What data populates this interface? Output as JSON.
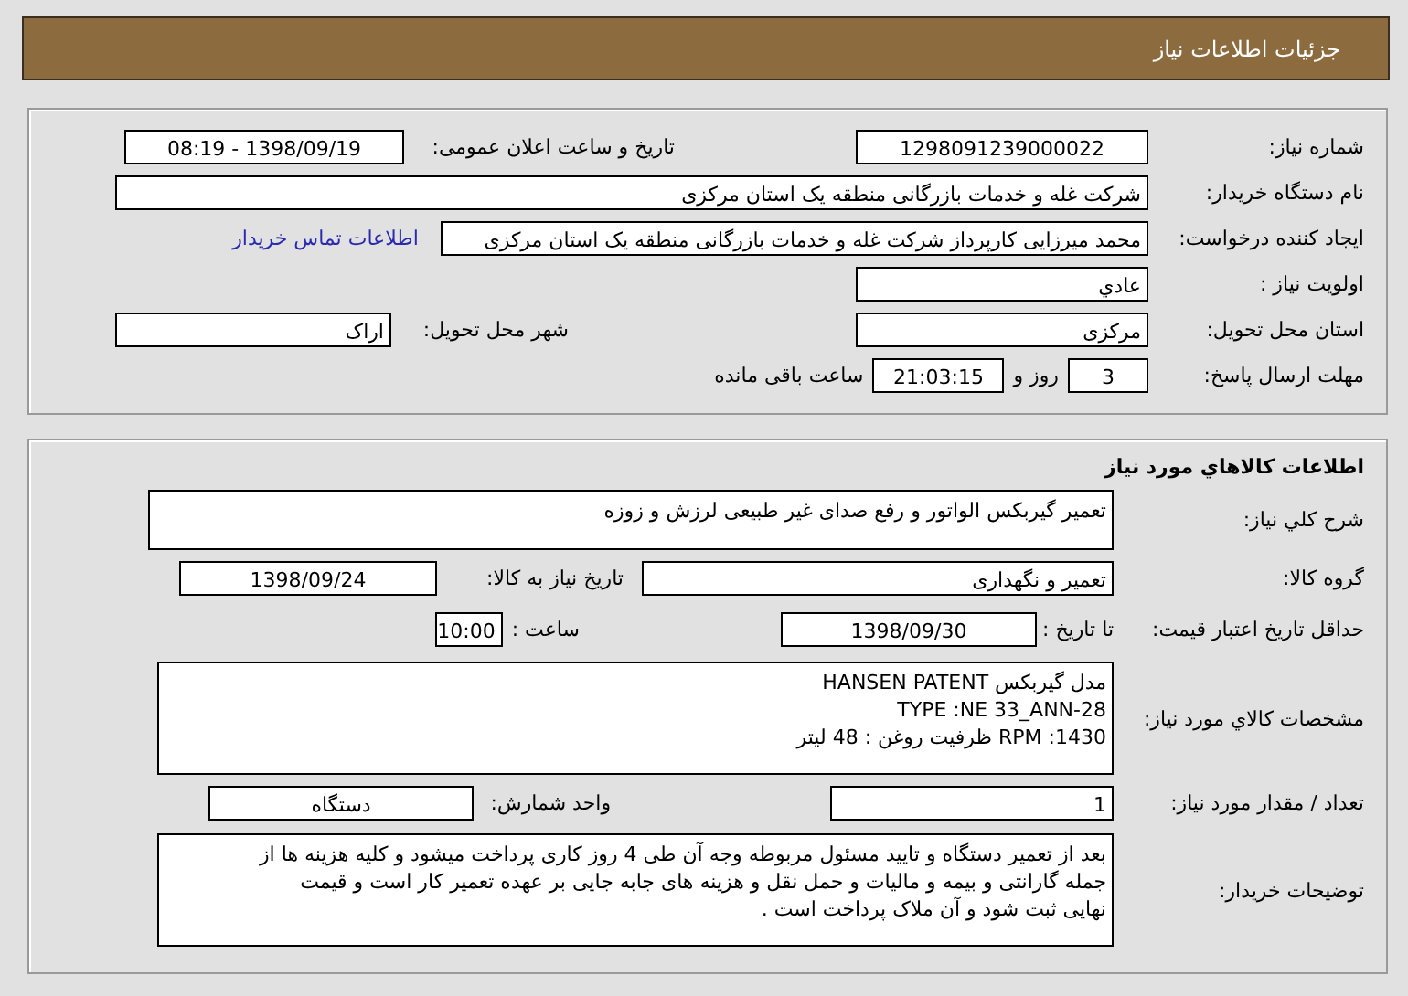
{
  "header": {
    "title": "جزئیات اطلاعات نیاز"
  },
  "need_info": {
    "need_number": {
      "label": "شماره نیاز:",
      "value": "1298091239000022"
    },
    "announce_datetime": {
      "label": "تاریخ و ساعت اعلان عمومی:",
      "value": "1398/09/19 - 08:19"
    },
    "buyer_org": {
      "label": "نام دستگاه خریدار:",
      "value": "شرکت غله و خدمات بازرگانی منطقه یک استان مرکزی"
    },
    "requester": {
      "label": "ایجاد کننده درخواست:",
      "value": "محمد میرزایی کارپرداز شرکت غله و خدمات بازرگانی منطقه یک استان مرکزی"
    },
    "contact_link": "اطلاعات تماس خریدار",
    "priority": {
      "label": "اولویت نیاز :",
      "value": "عادي"
    },
    "delivery_province": {
      "label": "استان محل تحویل:",
      "value": "مرکزی"
    },
    "delivery_city": {
      "label": "شهر محل تحویل:",
      "value": "اراک"
    },
    "deadline": {
      "label": "مهلت ارسال پاسخ:",
      "days": "3",
      "days_suffix": "روز و",
      "time": "21:03:15",
      "time_suffix": "ساعت باقی مانده"
    }
  },
  "goods": {
    "title": "اطلاعات کالاهاي مورد نیاز",
    "summary": {
      "label": "شرح کلي نیاز:",
      "value": "تعمیر گیربکس الواتور و رفع صدای غیر طبیعی لرزش و زوزه"
    },
    "group": {
      "label": "گروه کالا:",
      "value": "تعمیر و نگهداری"
    },
    "need_date": {
      "label": "تاریخ نیاز به کالا:",
      "value": "1398/09/24"
    },
    "price_validity": {
      "label": "حداقل تاریخ اعتبار قیمت:",
      "to_date_label": "تا تاریخ :",
      "date": "1398/09/30",
      "time_label": "ساعت :",
      "time": "10:00"
    },
    "specs": {
      "label": "مشخصات کالاي مورد نیاز:",
      "lines": [
        "مدل گیربکس HANSEN PATENT",
        "TYPE :NE 33_ANN-28",
        "1430: RPM  ظرفیت روغن : 48 لیتر"
      ]
    },
    "quantity": {
      "label": "تعداد / مقدار مورد نیاز:",
      "value": "1"
    },
    "unit": {
      "label": "واحد شمارش:",
      "value": "دستگاه"
    },
    "buyer_notes": {
      "label": "توضیحات خریدار:",
      "lines": [
        "بعد از تعمیر دستگاه و تایید مسئول مربوطه وجه آن طی  4 روز کاری پرداخت میشود و کلیه هزینه ها از",
        "جمله گارانتی و بیمه و مالیات و حمل نقل و هزینه های جابه جایی بر عهده تعمیر کار است و قیمت",
        "نهایی ثبت شود و آن ملاک پرداخت است ."
      ]
    }
  }
}
